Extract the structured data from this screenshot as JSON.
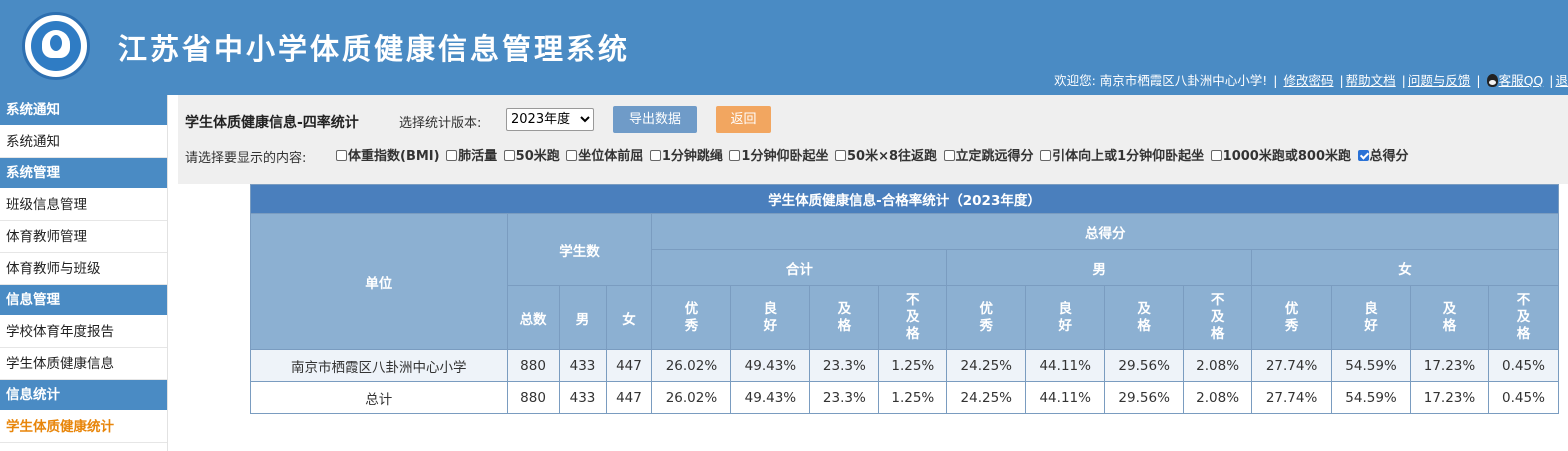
{
  "header": {
    "app_title": "江苏省中小学体质健康信息管理系统",
    "welcome": "欢迎您: 南京市栖霞区八卦洲中心小学!",
    "links": [
      "修改密码",
      "帮助文档",
      "问题与反馈",
      "客服QQ",
      "退"
    ]
  },
  "sidebar": {
    "sections": [
      {
        "title": "系统通知",
        "items": [
          {
            "label": "系统通知"
          }
        ]
      },
      {
        "title": "系统管理",
        "items": [
          {
            "label": "班级信息管理"
          },
          {
            "label": "体育教师管理"
          },
          {
            "label": "体育教师与班级"
          }
        ]
      },
      {
        "title": "信息管理",
        "items": [
          {
            "label": "学校体育年度报告"
          },
          {
            "label": "学生体质健康信息"
          }
        ]
      },
      {
        "title": "信息统计",
        "items": [
          {
            "label": "学生体质健康统计"
          }
        ]
      }
    ]
  },
  "toolbar": {
    "title": "学生体质健康信息-四率统计",
    "version_label": "选择统计版本:",
    "version_selected": "2023年度",
    "export_label": "导出数据",
    "back_label": "返回",
    "choose_label": "请选择要显示的内容:",
    "options": [
      {
        "label": "体重指数(BMI)",
        "checked": false
      },
      {
        "label": "肺活量",
        "checked": false
      },
      {
        "label": "50米跑",
        "checked": false
      },
      {
        "label": "坐位体前屈",
        "checked": false
      },
      {
        "label": "1分钟跳绳",
        "checked": false
      },
      {
        "label": "1分钟仰卧起坐",
        "checked": false
      },
      {
        "label": "50米×8往返跑",
        "checked": false
      },
      {
        "label": "立定跳远得分",
        "checked": false
      },
      {
        "label": "引体向上或1分钟仰卧起坐",
        "checked": false
      },
      {
        "label": "1000米跑或800米跑",
        "checked": false
      },
      {
        "label": "总得分",
        "checked": true
      }
    ]
  },
  "table": {
    "title": "学生体质健康信息-合格率统计（2023年度）",
    "unit_header": "单位",
    "student_count_header": "学生数",
    "score_header": "总得分",
    "group_headers": [
      "合计",
      "男",
      "女"
    ],
    "count_subheaders": [
      "总数",
      "男",
      "女"
    ],
    "rate_subheaders": [
      "优\n秀",
      "良\n好",
      "及\n格",
      "不\n及\n格"
    ],
    "rows": [
      {
        "unit": "南京市栖霞区八卦洲中心小学",
        "cells": [
          "880",
          "433",
          "447",
          "26.02%",
          "49.43%",
          "23.3%",
          "1.25%",
          "24.25%",
          "44.11%",
          "29.56%",
          "2.08%",
          "27.74%",
          "54.59%",
          "17.23%",
          "0.45%"
        ]
      },
      {
        "unit": "总计",
        "cells": [
          "880",
          "433",
          "447",
          "26.02%",
          "49.43%",
          "23.3%",
          "1.25%",
          "24.25%",
          "44.11%",
          "29.56%",
          "2.08%",
          "27.74%",
          "54.59%",
          "17.23%",
          "0.45%"
        ]
      }
    ]
  }
}
